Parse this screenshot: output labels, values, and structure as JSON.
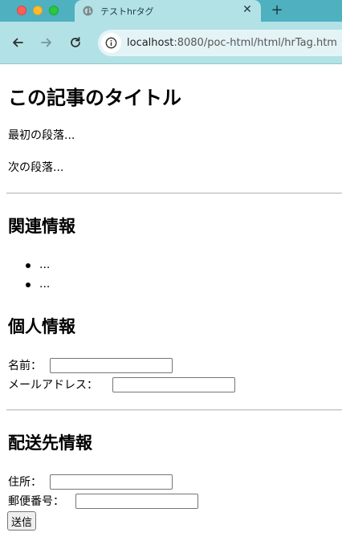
{
  "browser": {
    "tab_title": "テストhrタグ",
    "tab_close_glyph": "✕",
    "new_tab_glyph": "+",
    "url_host": "localhost",
    "url_path": ":8080/poc-html/html/hrTag.htm"
  },
  "page": {
    "title": "この記事のタイトル",
    "paragraphs": [
      "最初の段落...",
      "次の段落..."
    ],
    "related_heading": "関連情報",
    "related_items": [
      "...",
      "..."
    ],
    "personal_heading": "個人情報",
    "name_label": "名前：",
    "name_value": "",
    "email_label": "メールアドレス：",
    "email_value": "",
    "shipping_heading": "配送先情報",
    "address_label": "住所：",
    "address_value": "",
    "postal_label": "郵便番号：",
    "postal_value": "",
    "submit_label": "送信"
  },
  "colors": {
    "titlebar": "#4fb0c0",
    "toolbar": "#b2e2e6",
    "omnibox": "#e4f4f6"
  },
  "icons": {
    "back": "arrow-left-icon",
    "forward": "arrow-right-icon",
    "reload": "reload-icon",
    "site_info": "info-icon",
    "favicon": "globe-icon"
  }
}
